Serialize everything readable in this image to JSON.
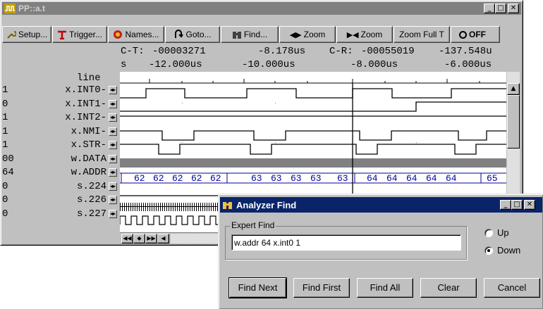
{
  "main_window": {
    "title": "PP::a.t",
    "toolbar": [
      {
        "label": "Setup...",
        "icon": "wrench-icon"
      },
      {
        "label": "Trigger...",
        "icon": "trigger-icon"
      },
      {
        "label": "Names...",
        "icon": "names-icon"
      },
      {
        "label": "Goto...",
        "icon": "goto-icon"
      },
      {
        "label": "Find...",
        "icon": "binoculars-icon"
      },
      {
        "label": "Zoom",
        "icon": "zoom-out-icon"
      },
      {
        "label": "Zoom",
        "icon": "zoom-in-icon"
      },
      {
        "label": "Zoom Full T",
        "icon": ""
      },
      {
        "label": "OFF",
        "icon": "radio-icon"
      }
    ],
    "cursor_info": {
      "ct_label": "C-T:",
      "ct_cycle": "-00003271",
      "ct_time": "-8.178us",
      "cr_label": "C-R:",
      "cr_cycle": "-00055019",
      "cr_time": "-137.548u"
    },
    "time_axis": {
      "unit": "s",
      "ticks": [
        "-12.000us",
        "-10.000us",
        "-8.000us",
        "-6.000us"
      ]
    },
    "column_header": "line",
    "signals": [
      {
        "value": "1",
        "name": "x.INT0-"
      },
      {
        "value": "0",
        "name": "x.INT1-"
      },
      {
        "value": "1",
        "name": "x.INT2-"
      },
      {
        "value": "1",
        "name": "x.NMI-"
      },
      {
        "value": "1",
        "name": "x.STR-"
      },
      {
        "value": "00",
        "name": "w.DATA"
      },
      {
        "value": "64",
        "name": "w.ADDR"
      },
      {
        "value": "0",
        "name": "s.224"
      },
      {
        "value": "0",
        "name": "s.226"
      },
      {
        "value": "0",
        "name": "s.227"
      }
    ],
    "addr_values": [
      "62",
      "62",
      "62",
      "62",
      "62",
      "63",
      "63",
      "63",
      "63",
      "63",
      "64",
      "64",
      "64",
      "64",
      "64",
      "65"
    ]
  },
  "find_dialog": {
    "title": "Analyzer Find",
    "group_label": "Expert Find",
    "expression": "w.addr 64 x.int0 1",
    "direction_up": "Up",
    "direction_down": "Down",
    "selected_direction": "Down",
    "buttons": [
      "Find Next",
      "Find First",
      "Find All",
      "Clear",
      "Cancel"
    ]
  },
  "colors": {
    "title_active": "#0a246a",
    "title_inactive": "#808080",
    "face": "#c0c0c0",
    "value_blue": "#0000a0"
  }
}
